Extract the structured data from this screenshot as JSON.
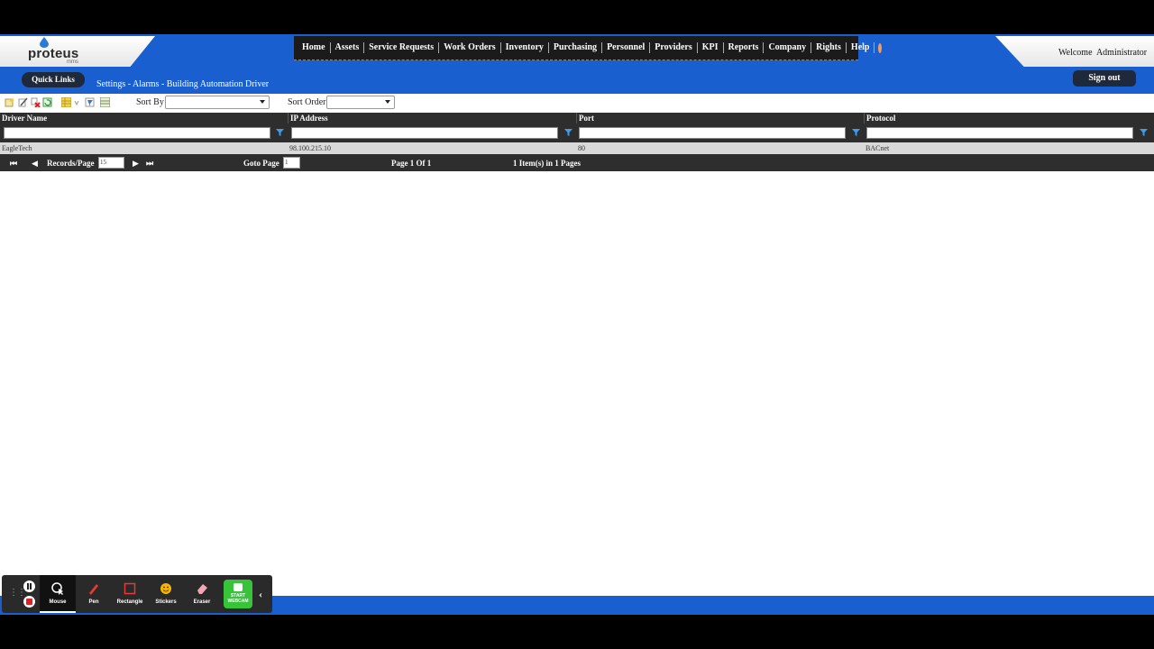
{
  "logo": {
    "name": "proteus",
    "sub": "mms"
  },
  "nav": {
    "items": [
      "Home",
      "Assets",
      "Service Requests",
      "Work Orders",
      "Inventory",
      "Purchasing",
      "Personnel",
      "Providers",
      "KPI",
      "Reports",
      "Company",
      "Rights",
      "Help"
    ],
    "gear_icon": "gear-icon"
  },
  "header": {
    "welcome": "Welcome  Administrator",
    "quick_links": "Quick Links",
    "breadcrumb": "Settings - Alarms - Building Automation Driver",
    "sign_out": "Sign out"
  },
  "toolbar": {
    "sort_by_label": "Sort By",
    "sort_by_value": "",
    "sort_order_label": "Sort Order",
    "sort_order_value": "",
    "icons": [
      "new-icon",
      "edit-icon",
      "delete-icon",
      "refresh-icon",
      "grid-view-icon",
      "column-chooser-icon",
      "filter-clear-icon",
      "layout-icon"
    ]
  },
  "grid": {
    "columns": [
      "Driver Name",
      "IP Address",
      "Port",
      "Protocol"
    ],
    "rows": [
      [
        "EagleTech",
        "98.100.215.10",
        "80",
        "BACnet"
      ]
    ]
  },
  "pager": {
    "records_label": "Records/Page",
    "records_value": "15",
    "goto_label": "Goto Page",
    "goto_value": "1",
    "page_info": "Page 1 Of 1",
    "items_info": "1 Item(s) in 1 Pages"
  },
  "recorder": {
    "tools": [
      "Mouse",
      "Pen",
      "Rectangle",
      "Stickers",
      "Eraser"
    ],
    "webcam_label": "START WEBCAM"
  },
  "colors": {
    "header_blue": "#1a5fcf",
    "nav_dark": "#1b1b1b",
    "grid_dark": "#2e2e2e",
    "row_gray": "#d9d9d9",
    "webcam_green": "#37c43a"
  }
}
